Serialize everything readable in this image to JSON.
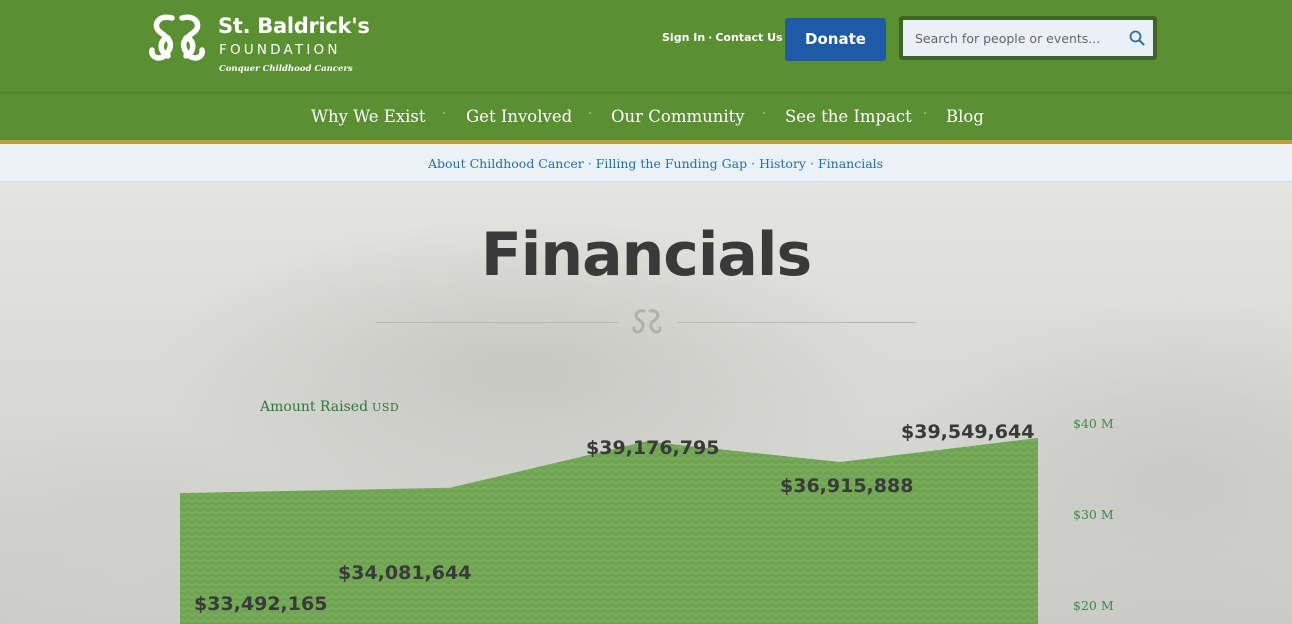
{
  "brand": {
    "name": "St. Baldrick's",
    "sub": "FOUNDATION",
    "tagline": "Conquer Childhood Cancers",
    "colors": {
      "green": "#5a8f32",
      "blue": "#1e5aa8",
      "gold": "#bf9d3e"
    }
  },
  "header": {
    "sign_in": "Sign In",
    "separator": "·",
    "contact": "Contact Us",
    "donate": "Donate",
    "search_placeholder": "Search for people or events...",
    "search_icon": "magnifier-icon"
  },
  "nav": {
    "items": [
      {
        "label": "Why We Exist"
      },
      {
        "label": "Get Involved"
      },
      {
        "label": "Our Community"
      },
      {
        "label": "See the Impact"
      },
      {
        "label": "Blog"
      }
    ],
    "separator": "·"
  },
  "subnav": {
    "items": [
      {
        "label": "About Childhood Cancer"
      },
      {
        "label": "Filling the Funding Gap"
      },
      {
        "label": "History"
      },
      {
        "label": "Financials"
      }
    ],
    "separator": "·"
  },
  "page": {
    "title": "Financials"
  },
  "chart_data": {
    "type": "area",
    "title": "Amount Raised",
    "unit": "USD",
    "values": [
      33492165,
      34081644,
      39176795,
      36915888,
      39549644
    ],
    "value_labels": [
      "$33,492,165",
      "$34,081,644",
      "$39,176,795",
      "$36,915,888",
      "$39,549,644"
    ],
    "y_ticks": [
      {
        "value": 40,
        "label": "$40 M"
      },
      {
        "value": 30,
        "label": "$30 M"
      },
      {
        "value": 20,
        "label": "$20 M"
      }
    ],
    "color": "#6fa552"
  }
}
